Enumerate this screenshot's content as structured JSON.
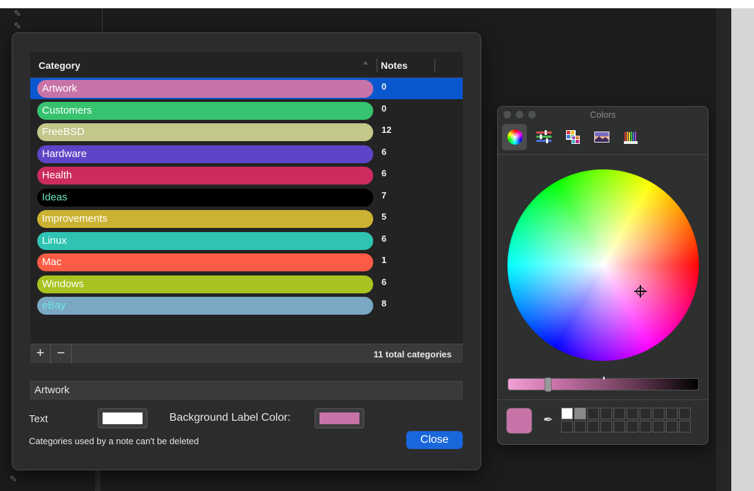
{
  "sheet": {
    "table": {
      "columns": {
        "category": "Category",
        "notes": "Notes",
        "sort_indicator": "^"
      },
      "rows": [
        {
          "label": "Artwork",
          "notes": "0",
          "bg": "#c873a8",
          "fg": "#ffffff",
          "selected": true
        },
        {
          "label": "Customers",
          "notes": "0",
          "bg": "#37c270",
          "fg": "#ffffff"
        },
        {
          "label": "FreeBSD",
          "notes": "12",
          "bg": "#c3c78a",
          "fg": "#ffffff"
        },
        {
          "label": "Hardware",
          "notes": "6",
          "bg": "#5e45c7",
          "fg": "#ffffff"
        },
        {
          "label": "Health",
          "notes": "6",
          "bg": "#cc2b5e",
          "fg": "#ffffff"
        },
        {
          "label": "Ideas",
          "notes": "7",
          "bg": "#000000",
          "fg": "#6ee6c2"
        },
        {
          "label": "Improvements",
          "notes": "5",
          "bg": "#ccb232",
          "fg": "#ffffff"
        },
        {
          "label": "Linux",
          "notes": "6",
          "bg": "#2fc4b2",
          "fg": "#ffffff"
        },
        {
          "label": "Mac",
          "notes": "1",
          "bg": "#fc5c45",
          "fg": "#ffffff"
        },
        {
          "label": "Windows",
          "notes": "6",
          "bg": "#a7c31f",
          "fg": "#ffffff"
        },
        {
          "label": "eBay",
          "notes": "8",
          "bg": "#7aa8c4",
          "fg": "#6ee6e6"
        }
      ]
    },
    "footer": {
      "add": "+",
      "remove": "−",
      "total": "11 total categories"
    },
    "name_field": "Artwork",
    "text_label": "Text",
    "text_color": "#ffffff",
    "bg_label": "Background Label Color:",
    "bg_color": "#c873a8",
    "hint": "Categories used by a note can't be deleted",
    "close_button": "Close"
  },
  "colors_panel": {
    "title": "Colors",
    "tabs": [
      "color-wheel",
      "color-sliders",
      "color-palettes",
      "image-palettes",
      "pencils"
    ],
    "current_color": "#c873a8",
    "brightness_fraction": 0.2,
    "eyedropper": "✒",
    "swatches": [
      "#ffffff",
      "#8a8a8a"
    ]
  }
}
